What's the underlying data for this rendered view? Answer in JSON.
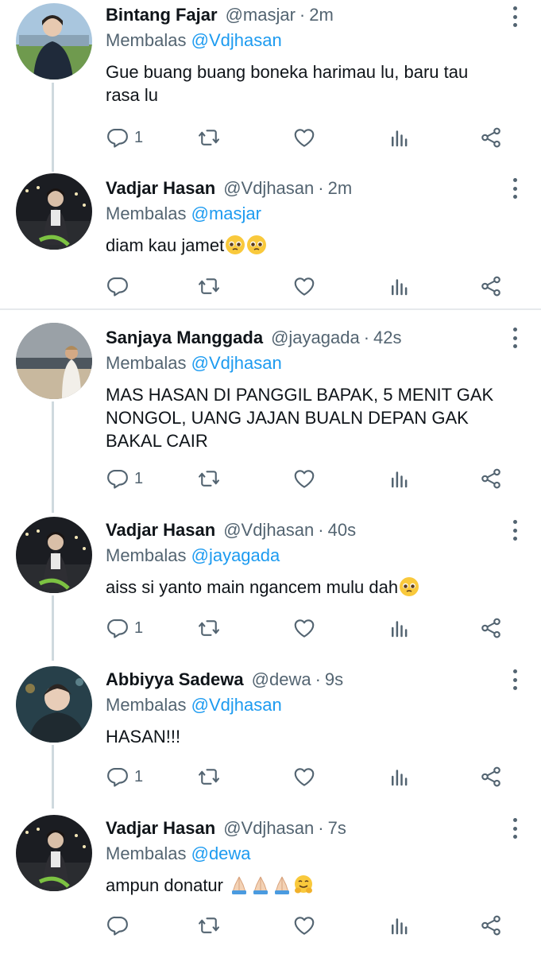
{
  "reply_prefix": "Membalas",
  "separator": " · ",
  "colors": {
    "mention": "#1d9bf0",
    "muted": "#536471",
    "thread_line": "#cfd9de"
  },
  "tweets": [
    {
      "name": "Bintang Fajar",
      "handle": "@masjar",
      "time": "2m",
      "reply_to": "@Vdjhasan",
      "text": "Gue buang buang boneka harimau lu, baru tau\nrasa lu",
      "reply_count": "1"
    },
    {
      "name": "Vadjar Hasan",
      "handle": "@Vdjhasan",
      "time": "2m",
      "reply_to": "@masjar",
      "text": "diam kau jamet",
      "emojis": [
        "pleading-face-emoji",
        "pleading-face-emoji"
      ],
      "reply_count": ""
    },
    {
      "name": "Sanjaya Manggada",
      "handle": "@jayagada",
      "time": "42s",
      "reply_to": "@Vdjhasan",
      "text": "MAS HASAN DI PANGGIL BAPAK, 5 MENIT GAK\nNONGOL, UANG JAJAN BUALN DEPAN GAK\nBAKAL CAIR",
      "reply_count": "1"
    },
    {
      "name": "Vadjar Hasan",
      "handle": "@Vdjhasan",
      "time": "40s",
      "reply_to": "@jayagada",
      "text": "aiss si yanto main ngancem mulu dah",
      "emojis": [
        "pleading-face-emoji"
      ],
      "reply_count": "1"
    },
    {
      "name": "Abbiyya Sadewa",
      "handle": "@dewa",
      "time": "9s",
      "reply_to": "@Vdjhasan",
      "text": "HASAN!!!",
      "reply_count": "1"
    },
    {
      "name": "Vadjar Hasan",
      "handle": "@Vdjhasan",
      "time": "7s",
      "reply_to": "@dewa",
      "text": "ampun donatur ",
      "emojis": [
        "folded-hands-emoji",
        "folded-hands-emoji",
        "folded-hands-emoji",
        "hugging-face-emoji"
      ],
      "reply_count": ""
    }
  ]
}
